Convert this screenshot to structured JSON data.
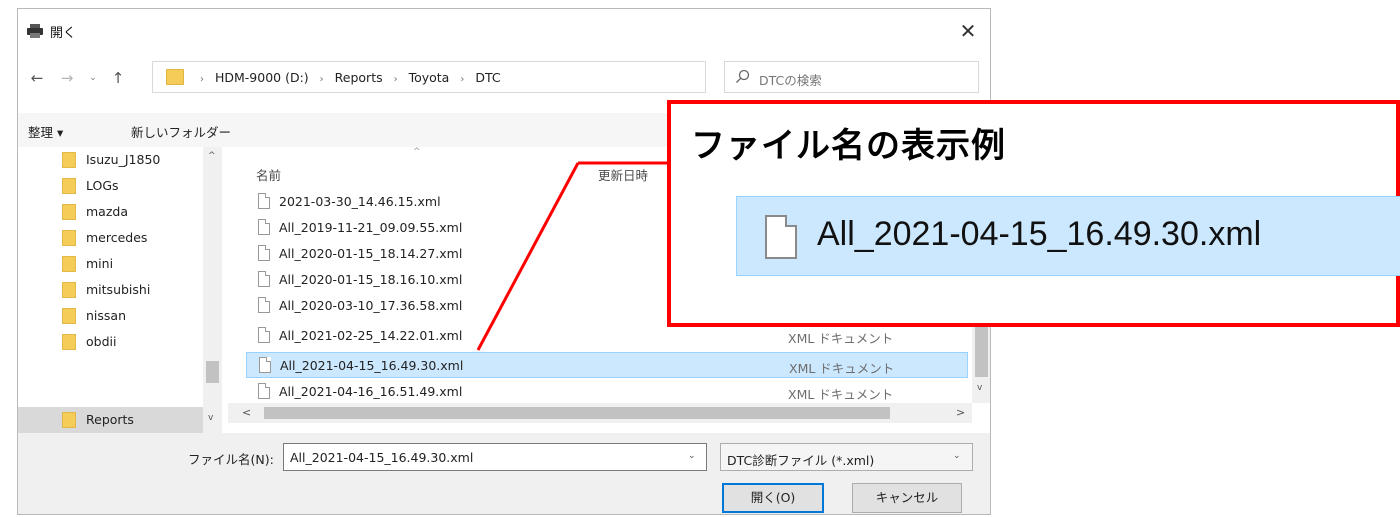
{
  "window": {
    "title": "開く",
    "close_glyph": "✕"
  },
  "navigation": {
    "back_glyph": "←",
    "forward_glyph": "→",
    "recent_glyph": "⌄",
    "up_glyph": "↑",
    "breadcrumbs": [
      "HDM-9000 (D:)",
      "Reports",
      "Toyota",
      "DTC"
    ],
    "breadcrumb_separator": "›",
    "dropdown_glyph": "⌄",
    "refresh_glyph": "↻",
    "search_placeholder": "DTCの検索"
  },
  "commands": {
    "organize": "整理 ▾",
    "new_folder": "新しいフォルダー"
  },
  "nav_pane": {
    "items": [
      {
        "label": "Isuzu_J1850"
      },
      {
        "label": "LOGs"
      },
      {
        "label": "mazda"
      },
      {
        "label": "mercedes"
      },
      {
        "label": "mini"
      },
      {
        "label": "mitsubishi"
      },
      {
        "label": "nissan"
      },
      {
        "label": "obdii"
      },
      {
        "label": "Reports",
        "selected": true
      }
    ],
    "scroll_up_glyph": "^",
    "scroll_down_glyph": "v"
  },
  "file_list": {
    "columns": {
      "name": "名前",
      "date": "更新日時",
      "sort_glyph": "^"
    },
    "rows": [
      {
        "name": "2021-03-30_14.46.15.xml",
        "type": ""
      },
      {
        "name": "All_2019-11-21_09.09.55.xml",
        "type": ""
      },
      {
        "name": "All_2020-01-15_18.14.27.xml",
        "type": ""
      },
      {
        "name": "All_2020-01-15_18.16.10.xml",
        "type": ""
      },
      {
        "name": "All_2020-03-10_17.36.58.xml",
        "type": ""
      },
      {
        "name": "All_2021-02-25_14.22.01.xml",
        "type": "XML ドキュメント"
      },
      {
        "name": "All_2021-04-15_16.49.30.xml",
        "type": "XML ドキュメント",
        "selected": true
      },
      {
        "name": "All_2021-04-16_16.51.49.xml",
        "type": "XML ドキュメント"
      }
    ],
    "scroll_left_glyph": "<",
    "scroll_right_glyph": ">",
    "scroll_down_glyph": "v"
  },
  "footer": {
    "filename_label": "ファイル名(N):",
    "filename_value": "All_2021-04-15_16.49.30.xml",
    "filter_value": "DTC診断ファイル (*.xml)",
    "dropdown_glyph": "⌄",
    "open_button": "開く(O)",
    "cancel_button": "キャンセル"
  },
  "callout": {
    "title": "ファイル名の表示例",
    "file_name": "All_2021-04-15_16.49.30.xml",
    "border_color": "#ff0000"
  },
  "colors": {
    "selection_bg": "#cce8ff",
    "selection_border": "#99d1ff",
    "folder": "#f5cc58",
    "accent": "#0078d7"
  }
}
